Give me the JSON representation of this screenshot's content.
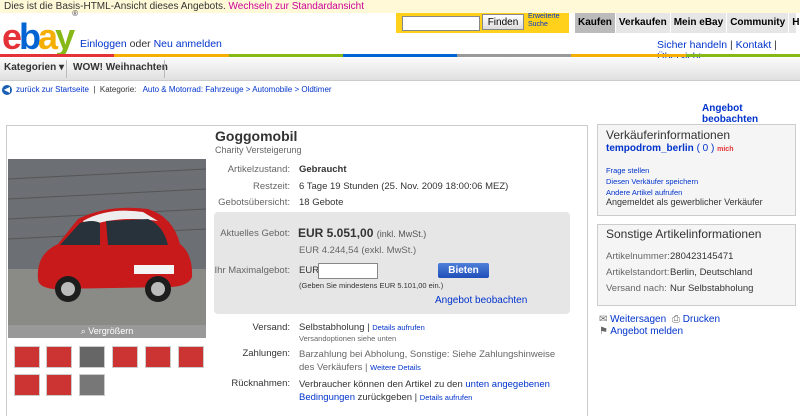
{
  "notice": {
    "text": "Dies ist die Basis-HTML-Ansicht dieses Angebots.",
    "link": "Wechseln zur Standardansicht"
  },
  "header": {
    "logo_letters": [
      "e",
      "b",
      "a",
      "y"
    ],
    "logo_tm": "®",
    "signin": "Einloggen",
    "or": "oder",
    "register": "Neu anmelden",
    "search_button": "Finden",
    "advanced_search": "Erweiterte Suche",
    "nav": [
      "Kaufen",
      "Verkaufen",
      "Mein eBay",
      "Community",
      "Hilfe"
    ],
    "right_links": [
      "Sicher handeln",
      "Kontakt",
      "Übersicht"
    ],
    "stripe_colors": [
      "#e53238",
      "#f5af02",
      "#86b817",
      "#0064d2",
      "#999999",
      "#f5af02",
      "#86b817"
    ]
  },
  "catbar": {
    "categories": "Kategorien",
    "wow": "WOW! Weihnachten"
  },
  "breadcrumb": {
    "back": "zurück zur Startseite",
    "label": "Kategorie:",
    "path": "Auto & Motorrad: Fahrzeuge > Automobile > Oldtimer"
  },
  "watch_top": "Angebot beobachten",
  "item": {
    "title": "Goggomobil",
    "subtitle": "Charity Versteigerung",
    "zoom": "Vergrößern",
    "rows": [
      {
        "label": "Artikelzustand:",
        "value": "Gebraucht"
      },
      {
        "label": "Restzeit:",
        "value": "6 Tage 19 Stunden (25. Nov. 2009 18:00:06 MEZ)"
      },
      {
        "label": "Gebotsübersicht:",
        "value": "18 Gebote"
      }
    ],
    "current_bid_label": "Aktuelles Gebot:",
    "price": "EUR 5.051,00",
    "price_note": "(inkl. MwSt.)",
    "price_excl": "EUR 4.244,54 (exkl. MwSt.)",
    "max_bid_label": "Ihr Maximalgebot:",
    "currency": "EUR",
    "bid_button": "Bieten",
    "min_note": "(Geben Sie mindestens EUR 5.101,00 ein.)",
    "watch": "Angebot beobachten",
    "shipping_label": "Versand:",
    "shipping_value": "Selbstabholung",
    "shipping_link": "Details aufrufen",
    "shipping_note": "Versandoptionen siehe unten",
    "payment_label": "Zahlungen:",
    "payment_value": "Barzahlung bei Abholung, Sonstige: Siehe Zahlungshinweise des Verkäufers",
    "payment_link": "Weitere Details",
    "returns_label": "Rücknahmen:",
    "returns_value": "Verbraucher können den Artikel zu den",
    "returns_link1": "unten angegebenen Bedingungen",
    "returns_value2": "zurückgeben",
    "returns_link2": "Details aufrufen"
  },
  "seller": {
    "head": "Verkäuferinformationen",
    "name": "tempodrom_berlin",
    "score": "( 0 )",
    "me": "mich",
    "links": [
      "Frage stellen",
      "Diesen Verkäufer speichern",
      "Andere Artikel aufrufen"
    ],
    "note": "Angemeldet als gewerblicher Verkäufer"
  },
  "info": {
    "head": "Sonstige Artikelinformationen",
    "rows": [
      {
        "label": "Artikelnummer:",
        "value": "280423145471"
      },
      {
        "label": "Artikelstandort:",
        "value": "Berlin, Deutschland"
      },
      {
        "label": "Versand nach:",
        "value": "Nur Selbstabholung"
      }
    ]
  },
  "actions": {
    "share": "Weitersagen",
    "print": "Drucken",
    "report": "Angebot melden"
  }
}
